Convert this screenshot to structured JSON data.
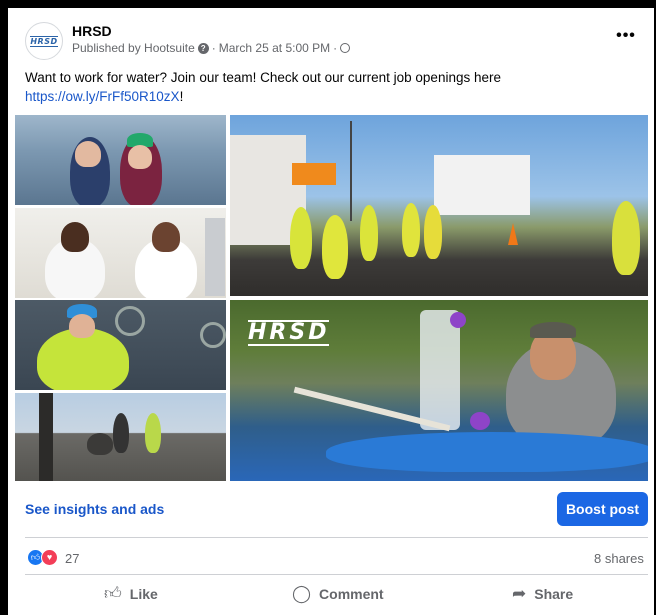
{
  "post": {
    "avatar_text": "HRSD",
    "page_name": "HRSD",
    "published_by": "Published by Hootsuite",
    "date": "March 25 at 5:00 PM",
    "more_icon": "more-horizontal-icon",
    "caption": "Want to work for water? Join our team! Check out our current job openings here",
    "link": "https://ow.ly/FrFf50R10zX",
    "link_suffix": "!"
  },
  "photos": {
    "watermark": "HRSD"
  },
  "footer": {
    "insights_label": "See insights and ads",
    "boost_label": "Boost post",
    "reaction_count": "27",
    "shares": "8 shares",
    "like_label": "Like",
    "comment_label": "Comment",
    "share_label": "Share"
  },
  "colors": {
    "link": "#1a57c9",
    "boost": "#1b67e4",
    "like_reaction": "#1877f2",
    "love_reaction": "#f33e58"
  }
}
